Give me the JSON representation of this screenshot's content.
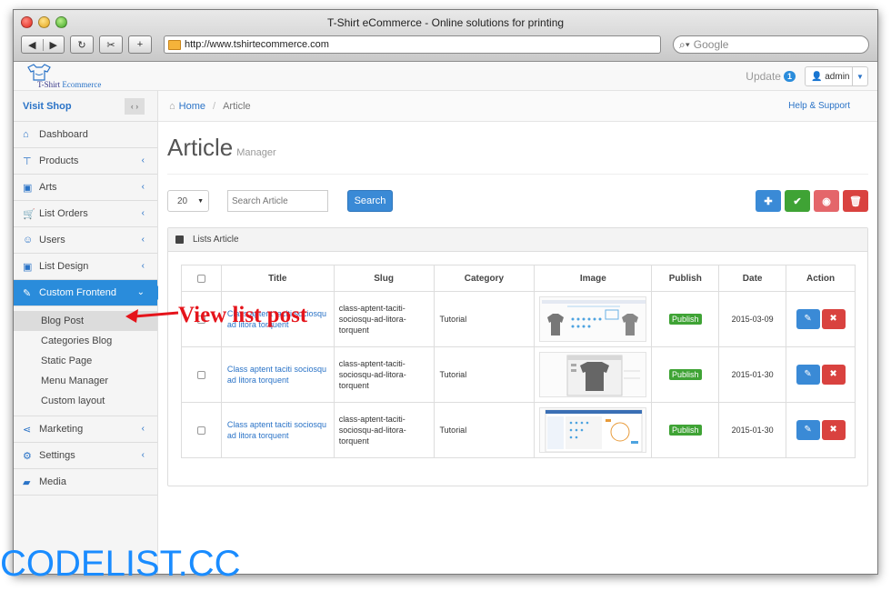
{
  "browser": {
    "window_title": "T-Shirt eCommerce - Online solutions for printing",
    "url": "http://www.tshirtecommerce.com",
    "search_placeholder": "Google"
  },
  "header": {
    "logo_text_1": "T-Shirt",
    "logo_text_2": "Ecommerce",
    "update_label": "Update",
    "update_count": "1",
    "user": "admin"
  },
  "sidebar": {
    "visit_shop": "Visit Shop",
    "items": [
      {
        "label": "Dashboard",
        "icon": "home-icon"
      },
      {
        "label": "Products",
        "icon": "tshirt-icon"
      },
      {
        "label": "Arts",
        "icon": "image-icon"
      },
      {
        "label": "List Orders",
        "icon": "cart-icon"
      },
      {
        "label": "Users",
        "icon": "users-icon"
      },
      {
        "label": "List Design",
        "icon": "picture-icon"
      },
      {
        "label": "Custom Frontend",
        "icon": "pencil-icon"
      }
    ],
    "sub_items": [
      "Blog Post",
      "Categories Blog",
      "Static Page",
      "Menu Manager",
      "Custom layout"
    ],
    "bottom_items": [
      {
        "label": "Marketing",
        "icon": "share-icon"
      },
      {
        "label": "Settings",
        "icon": "gear-icon"
      },
      {
        "label": "Media",
        "icon": "folder-icon"
      }
    ]
  },
  "breadcrumb": {
    "home": "Home",
    "current": "Article",
    "help": "Help & Support"
  },
  "page": {
    "title": "Article",
    "subtitle": "Manager"
  },
  "toolbar": {
    "per_page": "20",
    "search_placeholder": "Search Article",
    "search_button": "Search"
  },
  "panel": {
    "title": "Lists Article"
  },
  "table": {
    "columns": [
      "Title",
      "Slug",
      "Category",
      "Image",
      "Publish",
      "Date",
      "Action"
    ],
    "rows": [
      {
        "title": "Class aptent taciti sociosqu ad litora torquent",
        "slug": "class-aptent-taciti-sociosqu-ad-litora-torquent",
        "category": "Tutorial",
        "publish": "Publish",
        "date": "2015-03-09"
      },
      {
        "title": "Class aptent taciti sociosqu ad litora torquent",
        "slug": "class-aptent-taciti-sociosqu-ad-litora-torquent",
        "category": "Tutorial",
        "publish": "Publish",
        "date": "2015-01-30"
      },
      {
        "title": "Class aptent taciti sociosqu ad litora torquent",
        "slug": "class-aptent-taciti-sociosqu-ad-litora-torquent",
        "category": "Tutorial",
        "publish": "Publish",
        "date": "2015-01-30"
      }
    ]
  },
  "annotation": {
    "callout": "View list post",
    "watermark": "CODELIST.CC",
    "color": "#e5141b"
  },
  "colors": {
    "accent": "#2a8cdb",
    "success": "#3fa335",
    "danger": "#d9423f"
  }
}
